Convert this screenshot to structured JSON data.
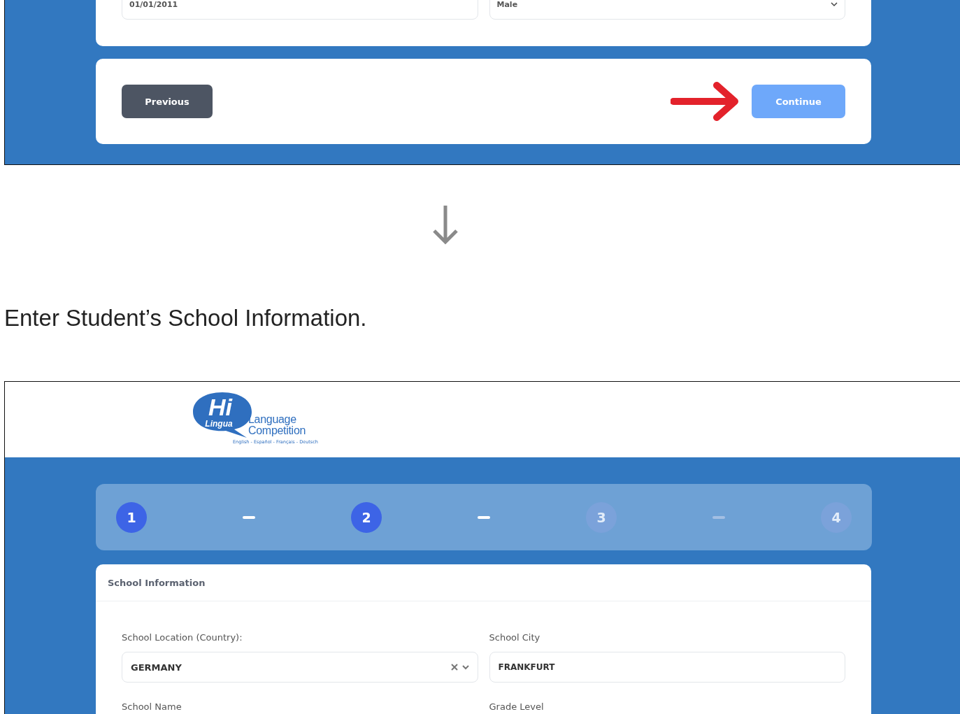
{
  "top_screen": {
    "fields": [
      {
        "kind": "text",
        "value": "01/01/2011"
      },
      {
        "kind": "select",
        "value": "Male"
      }
    ],
    "previous_button": "Previous",
    "continue_button": "Continue"
  },
  "instruction": "Enter Student’s School Information.",
  "bottom_screen": {
    "logo": {
      "mark": "Hi",
      "script": "Lingua",
      "title_line_1": "Language",
      "title_line_2": "Competition",
      "languages": "English - Español - Français - Deutsch"
    },
    "steps": [
      {
        "label": "1",
        "active": true
      },
      {
        "label": "2",
        "active": true
      },
      {
        "label": "3",
        "active": false
      },
      {
        "label": "4",
        "active": false
      }
    ],
    "section_title": "School Information",
    "fields": [
      {
        "kind": "combo",
        "label": "School Location (Country):",
        "value": "GERMANY"
      },
      {
        "kind": "text",
        "label": "School City",
        "value": "FRANKFURT"
      },
      {
        "kind": "text",
        "label": "School Name"
      },
      {
        "kind": "text",
        "label": "Grade Level"
      }
    ]
  }
}
